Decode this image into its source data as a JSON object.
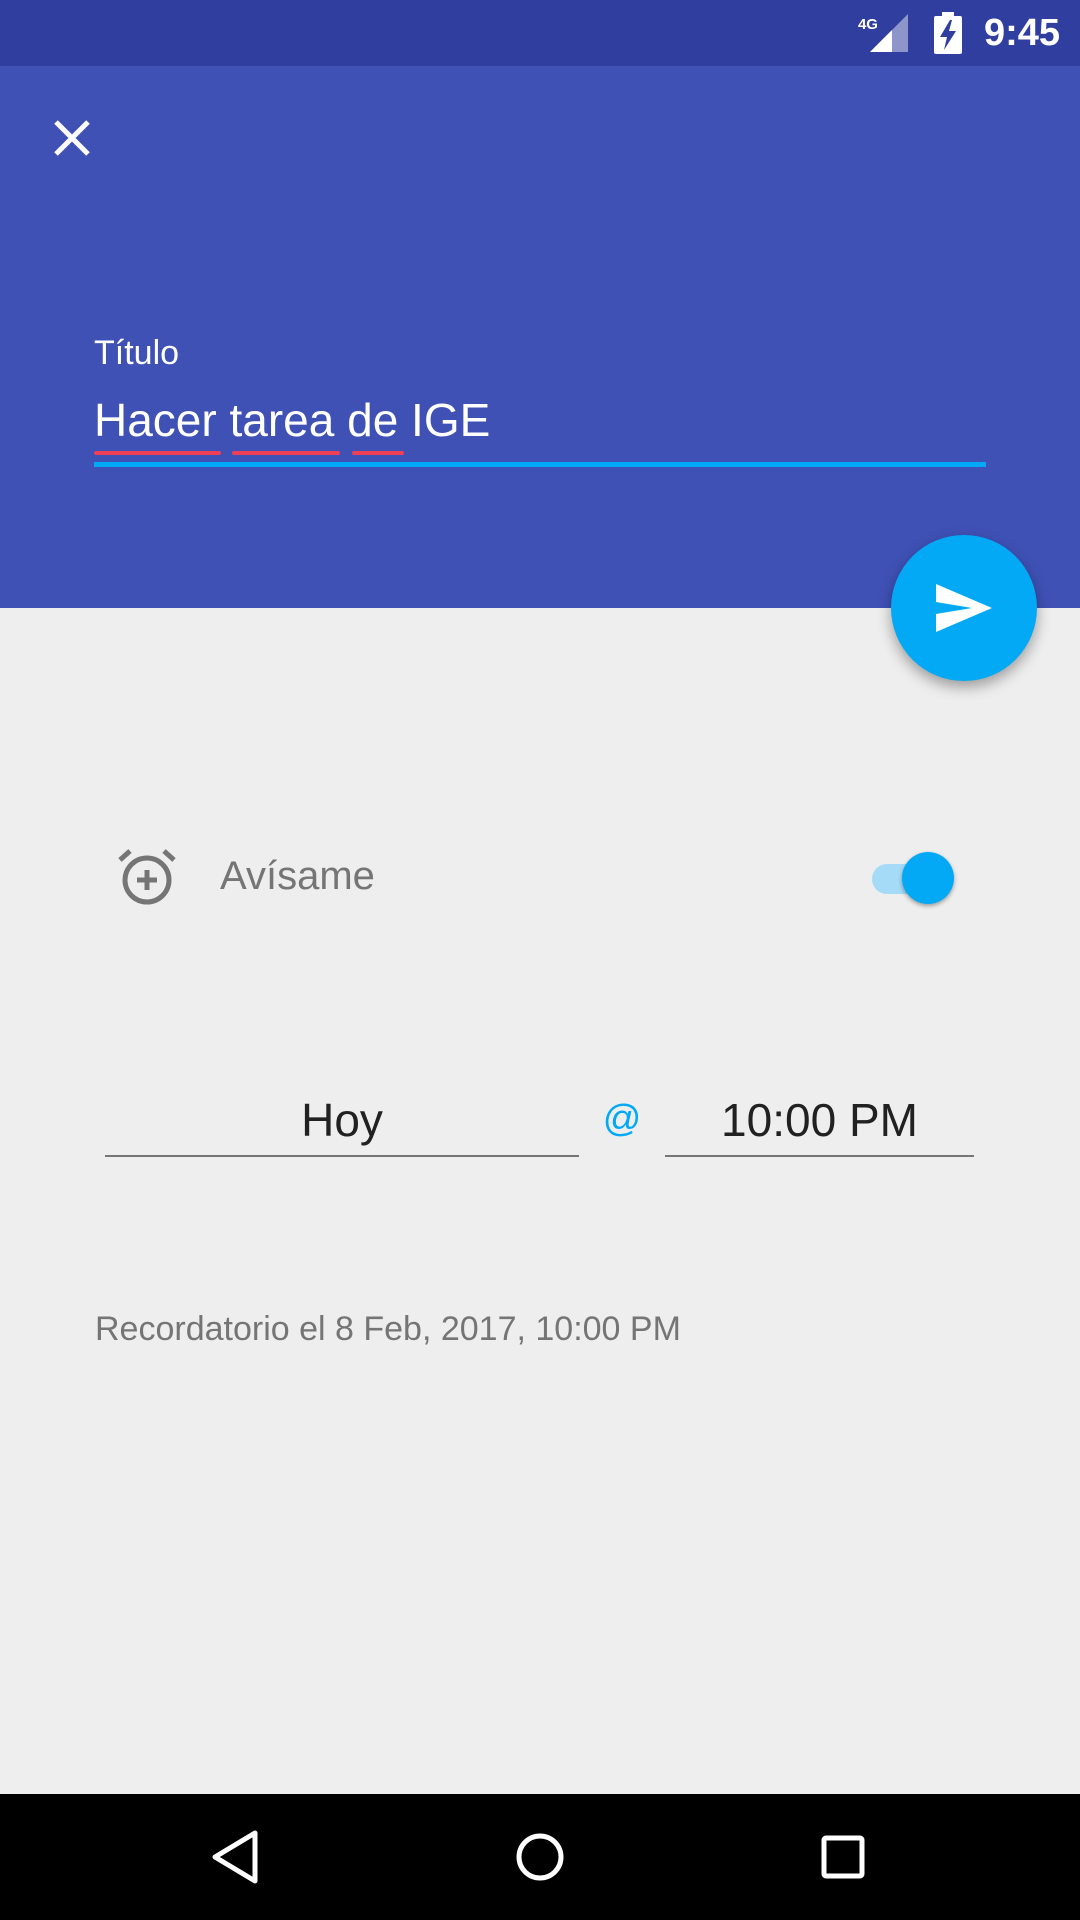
{
  "status_bar": {
    "network": "4G",
    "time": "9:45",
    "icons": [
      "signal-icon",
      "battery-charging-icon"
    ]
  },
  "header": {
    "close_icon": "close-icon",
    "title_label": "Título",
    "title_value": "Hacer tarea de IGE",
    "title_words": [
      "Hacer",
      "tarea",
      "de",
      "IGE"
    ]
  },
  "fab": {
    "icon": "send-icon"
  },
  "reminder": {
    "icon": "alarm-add-icon",
    "label": "Avísame",
    "enabled": true
  },
  "schedule": {
    "date": "Hoy",
    "separator": "@",
    "time": "10:00 PM"
  },
  "summary": "Recordatorio el 8 Feb, 2017, 10:00 PM",
  "nav_bar": {
    "icons": [
      "back-icon",
      "home-icon",
      "recents-icon"
    ]
  },
  "colors": {
    "primary": "#3f51b5",
    "primary_dark": "#303f9f",
    "accent": "#03a9f4",
    "background": "#eeeeee"
  }
}
